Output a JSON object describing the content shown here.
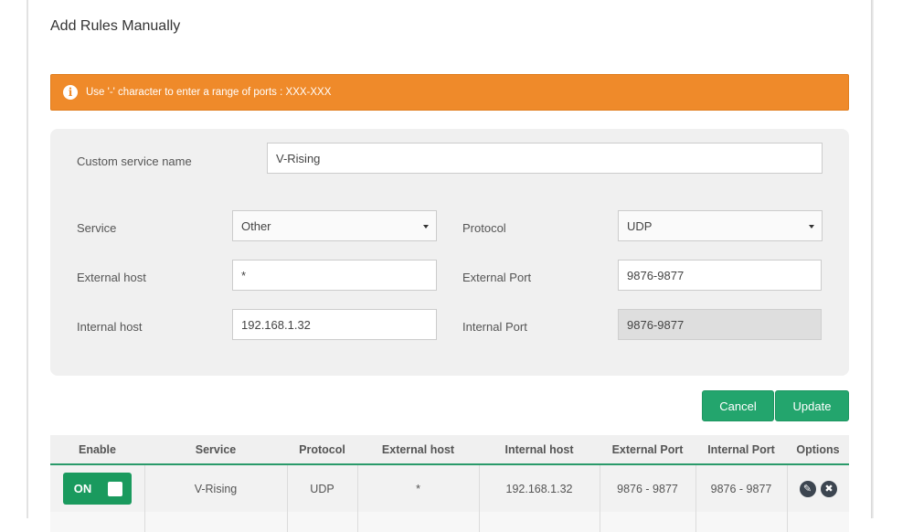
{
  "header": {
    "title": "Add Rules Manually"
  },
  "alert": {
    "icon": "info-icon",
    "icon_glyph": "i",
    "text": "Use '-' character to enter a range of ports : XXX-XXX",
    "color": "#ef8a2a"
  },
  "form": {
    "custom_service_name": {
      "label": "Custom service name",
      "value": "V-Rising"
    },
    "service": {
      "label": "Service",
      "value": "Other"
    },
    "protocol": {
      "label": "Protocol",
      "value": "UDP"
    },
    "external_host": {
      "label": "External host",
      "value": "*"
    },
    "external_port": {
      "label": "External Port",
      "value": "9876-9877"
    },
    "internal_host": {
      "label": "Internal host",
      "value": "192.168.1.32"
    },
    "internal_port": {
      "label": "Internal Port",
      "value": "9876-9877"
    }
  },
  "buttons": {
    "cancel": "Cancel",
    "update": "Update",
    "color": "#23a56d"
  },
  "table": {
    "headers": [
      "Enable",
      "Service",
      "Protocol",
      "External host",
      "Internal host",
      "External Port",
      "Internal Port",
      "Options"
    ],
    "rows": [
      {
        "enable": "ON",
        "service": "V-Rising",
        "protocol": "UDP",
        "external_host": "*",
        "internal_host": "192.168.1.32",
        "external_port": "9876 - 9877",
        "internal_port": "9876 - 9877",
        "options": {
          "edit_icon": "pencil-icon",
          "edit_glyph": "✎",
          "delete_icon": "close-icon",
          "delete_glyph": "✖"
        }
      }
    ]
  }
}
